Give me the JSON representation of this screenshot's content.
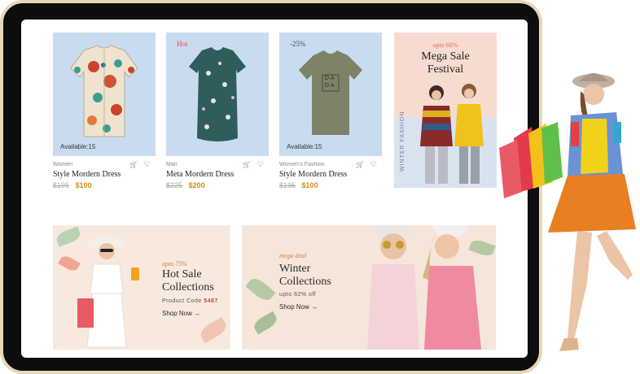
{
  "products": [
    {
      "category": "Women",
      "title": "Style Mordern Dress",
      "old_price": "$195",
      "new_price": "$100",
      "stock": "Available:15",
      "badge": ""
    },
    {
      "category": "Man",
      "title": "Meta Mordern Dress",
      "old_price": "$225",
      "new_price": "$200",
      "stock": "",
      "badge": "Hot"
    },
    {
      "category": "Women's Fashion",
      "title": "Style Mordern Dress",
      "old_price": "$195",
      "new_price": "$100",
      "stock": "Available:15",
      "badge": "-25%"
    }
  ],
  "tshirt_print": [
    "DA",
    "DA"
  ],
  "mega": {
    "upto": "upto 68%",
    "line1": "Mega Sale",
    "line2": "Festival",
    "side": "WINTER FASHION"
  },
  "hot_sale": {
    "script": "upto 75%",
    "line1": "Hot Sale",
    "line2": "Collections",
    "code_label": "Product Code",
    "code_value": "5487",
    "cta": "Shop Now →"
  },
  "winter": {
    "script": "mega deal",
    "line1": "Winter",
    "line2": "Collections",
    "sub": "upto 62% off",
    "cta": "Shop Now →"
  },
  "icons": {
    "cart": "cart-icon",
    "heart": "heart-icon"
  },
  "colors": {
    "accent_price": "#d68c1a",
    "hot_badge": "#e0533c",
    "card_bg": "#c9dcef"
  }
}
